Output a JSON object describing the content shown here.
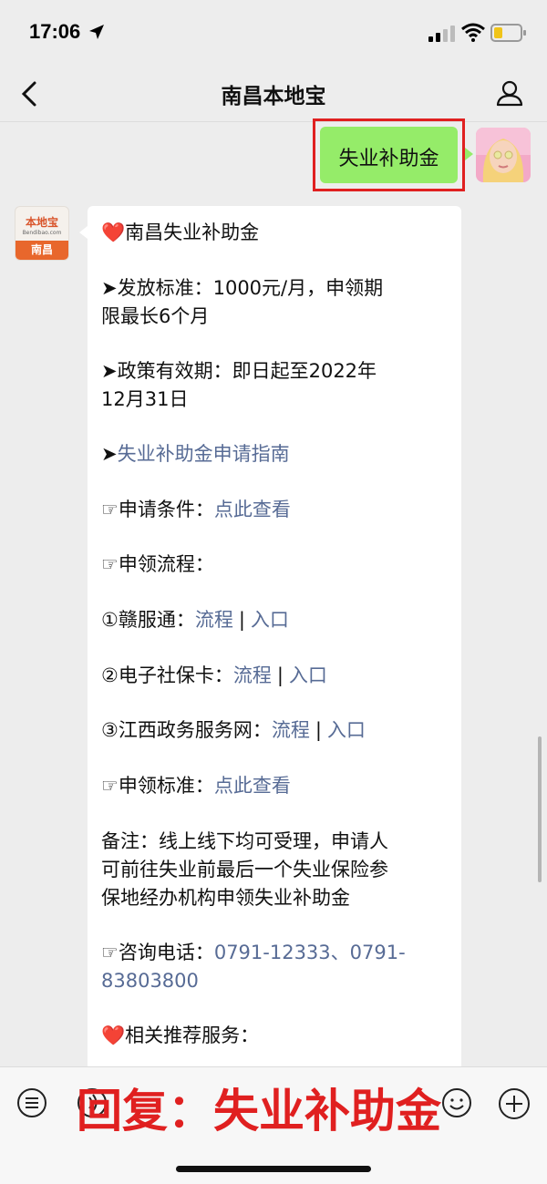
{
  "status_bar": {
    "time": "17:06"
  },
  "nav": {
    "title": "南昌本地宝"
  },
  "sent_message": {
    "text": "失业补助金"
  },
  "bot_avatar": {
    "logo_top": "本地宝",
    "logo_url": "Bendibao.com",
    "logo_bottom": "南昌"
  },
  "message": {
    "title_heart": "❤️",
    "title": "南昌失业补助金",
    "standard_line1": "➤发放标准：1000元/月，申领期",
    "standard_line2": "限最长6个月",
    "validity_line1": "➤政策有效期：即日起至2022年",
    "validity_line2": "12月31日",
    "guide_arrow": "➤",
    "guide_link": "失业补助金申请指南",
    "conditions_label": "☞申请条件：",
    "conditions_link": "点此查看",
    "process_label": "☞申领流程：",
    "channels": [
      {
        "label": "①赣服通：",
        "flow": "流程",
        "entry": "入口"
      },
      {
        "label": "②电子社保卡：",
        "flow": "流程",
        "entry": "入口"
      },
      {
        "label": "③江西政务服务网：",
        "flow": "流程",
        "entry": "入口"
      }
    ],
    "separator": "|",
    "standard_label": "☞申领标准：",
    "standard_link": "点此查看",
    "note_line1": "备注：线上线下均可受理，申请人",
    "note_line2": "可前往失业前最后一个失业保险参",
    "note_line3": "保地经办机构申领失业补助金",
    "phone_label": "☞咨询电话：",
    "phone_line1": "0791-12333、0791-",
    "phone_line2": "83803800",
    "related_heart": "❤️",
    "related": "相关推荐服务："
  },
  "reply_overlay": "回复：失业补助金",
  "colors": {
    "accent_link": "#576b95",
    "sent_bubble": "#95ec69",
    "highlight": "#e02020"
  }
}
